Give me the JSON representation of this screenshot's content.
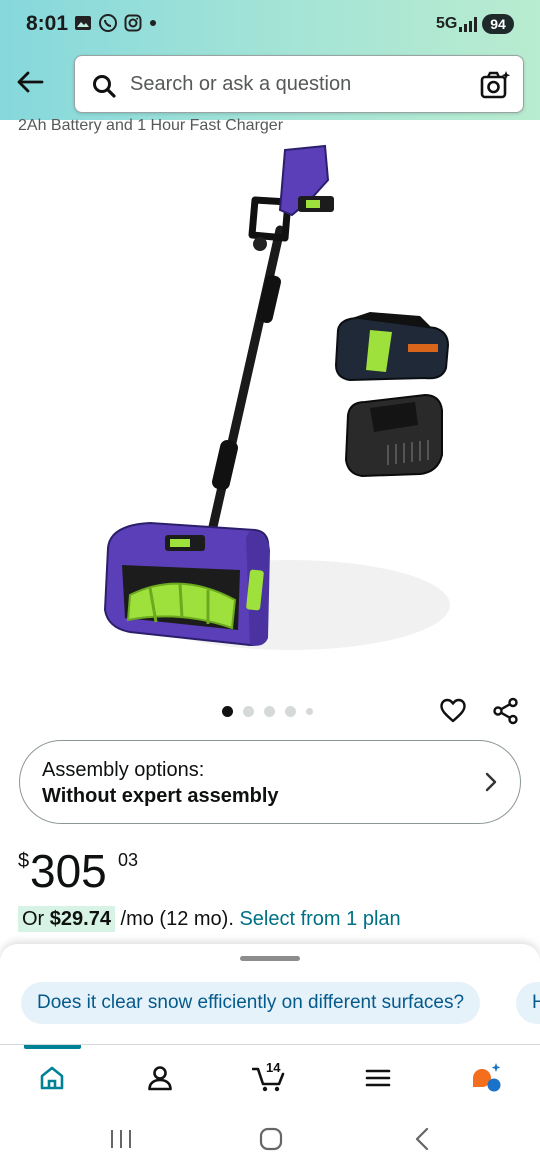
{
  "status": {
    "time": "8:01",
    "network": "5G",
    "battery": "94"
  },
  "search": {
    "placeholder": "Search or ask a question"
  },
  "product": {
    "title_fragment": "2Ah Battery and 1 Hour Fast Charger",
    "image_count": 5,
    "image_active_index": 0
  },
  "assembly": {
    "label": "Assembly options:",
    "value": "Without expert assembly"
  },
  "price": {
    "symbol": "$",
    "whole": "305",
    "fraction": "03"
  },
  "monthly": {
    "prefix": "Or ",
    "amount": "$29.74",
    "per": " /mo (12 mo). ",
    "link": "Select from 1 plan"
  },
  "suggestions": [
    {
      "text": "Does it clear snow efficiently on different surfaces?"
    },
    {
      "text": "H"
    }
  ],
  "nav": {
    "cart_count": "14",
    "active": "home"
  },
  "colors": {
    "header_gradient_start": "#86d8dc",
    "header_gradient_end": "#b9ecd0",
    "link": "#007185",
    "chip_bg": "#e6f2fa",
    "nav_indicator": "#008296",
    "price_highlight": "#d7f3e6",
    "product_purple": "#5b3fb8",
    "product_green": "#9ee03c"
  }
}
